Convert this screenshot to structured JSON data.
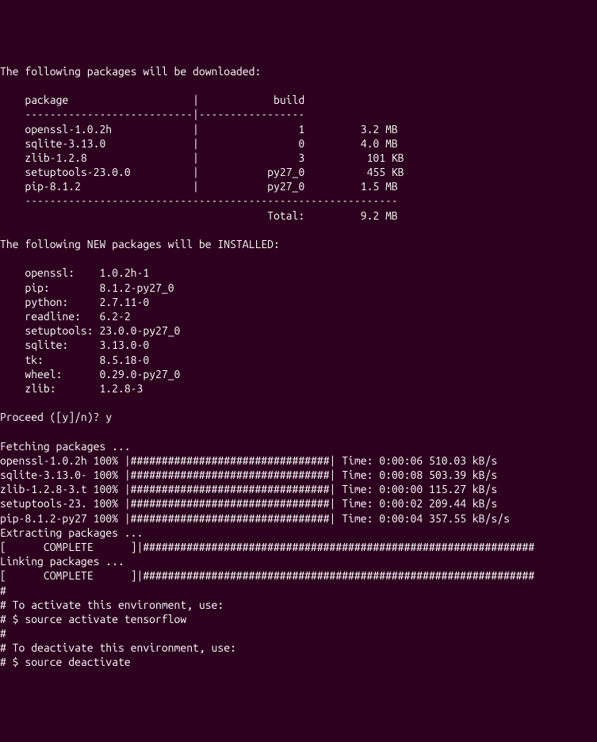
{
  "header": {
    "downloaded_msg": "The following packages will be downloaded:",
    "col_package": "package",
    "col_build": "build",
    "sep1": "    ---------------------------|-----------------",
    "sep2": "    ------------------------------------------------------------"
  },
  "download_table": [
    {
      "pkg": "openssl-1.0.2h",
      "build": "1",
      "size": "3.2 MB"
    },
    {
      "pkg": "sqlite-3.13.0",
      "build": "0",
      "size": "4.0 MB"
    },
    {
      "pkg": "zlib-1.2.8",
      "build": "3",
      "size": "101 KB"
    },
    {
      "pkg": "setuptools-23.0.0",
      "build": "py27_0",
      "size": "455 KB"
    },
    {
      "pkg": "pip-8.1.2",
      "build": "py27_0",
      "size": "1.5 MB"
    }
  ],
  "total_label": "Total:",
  "total_size": "9.2 MB",
  "installed_msg": "The following NEW packages will be INSTALLED:",
  "install_list": [
    {
      "name": "openssl:",
      "ver": "1.0.2h-1"
    },
    {
      "name": "pip:",
      "ver": "8.1.2-py27_0"
    },
    {
      "name": "python:",
      "ver": "2.7.11-0"
    },
    {
      "name": "readline:",
      "ver": "6.2-2"
    },
    {
      "name": "setuptools:",
      "ver": "23.0.0-py27_0"
    },
    {
      "name": "sqlite:",
      "ver": "3.13.0-0"
    },
    {
      "name": "tk:",
      "ver": "8.5.18-0"
    },
    {
      "name": "wheel:",
      "ver": "0.29.0-py27_0"
    },
    {
      "name": "zlib:",
      "ver": "1.2.8-3"
    }
  ],
  "proceed_prompt": "Proceed ([y]/n)? ",
  "proceed_answer": "y",
  "fetching_msg": "Fetching packages ...",
  "fetch_table": [
    {
      "pkg": "openssl-1.0.2h",
      "pct": "100%",
      "time": "0:00:06",
      "rate": "510.03 kB/s"
    },
    {
      "pkg": "sqlite-3.13.0-",
      "pct": "100%",
      "time": "0:00:08",
      "rate": "503.39 kB/s"
    },
    {
      "pkg": "zlib-1.2.8-3.t",
      "pct": "100%",
      "time": "0:00:00",
      "rate": "115.27 kB/s"
    },
    {
      "pkg": "setuptools-23.",
      "pct": "100%",
      "time": "0:00:02",
      "rate": "209.44 kB/s"
    },
    {
      "pkg": "pip-8.1.2-py27",
      "pct": "100%",
      "time": "0:00:04",
      "rate": "357.55 kB/s/s"
    }
  ],
  "bar": "|################################|",
  "time_label": "Time:",
  "extracting_msg": "Extracting packages ...",
  "complete_line": "[      COMPLETE      ]|###############################################################",
  "linking_msg": "Linking packages ...",
  "hash": "#",
  "activate_msg": "# To activate this environment, use:",
  "activate_cmd": "# $ source activate tensorflow",
  "deactivate_msg": "# To deactivate this environment, use:",
  "deactivate_cmd": "# $ source deactivate"
}
